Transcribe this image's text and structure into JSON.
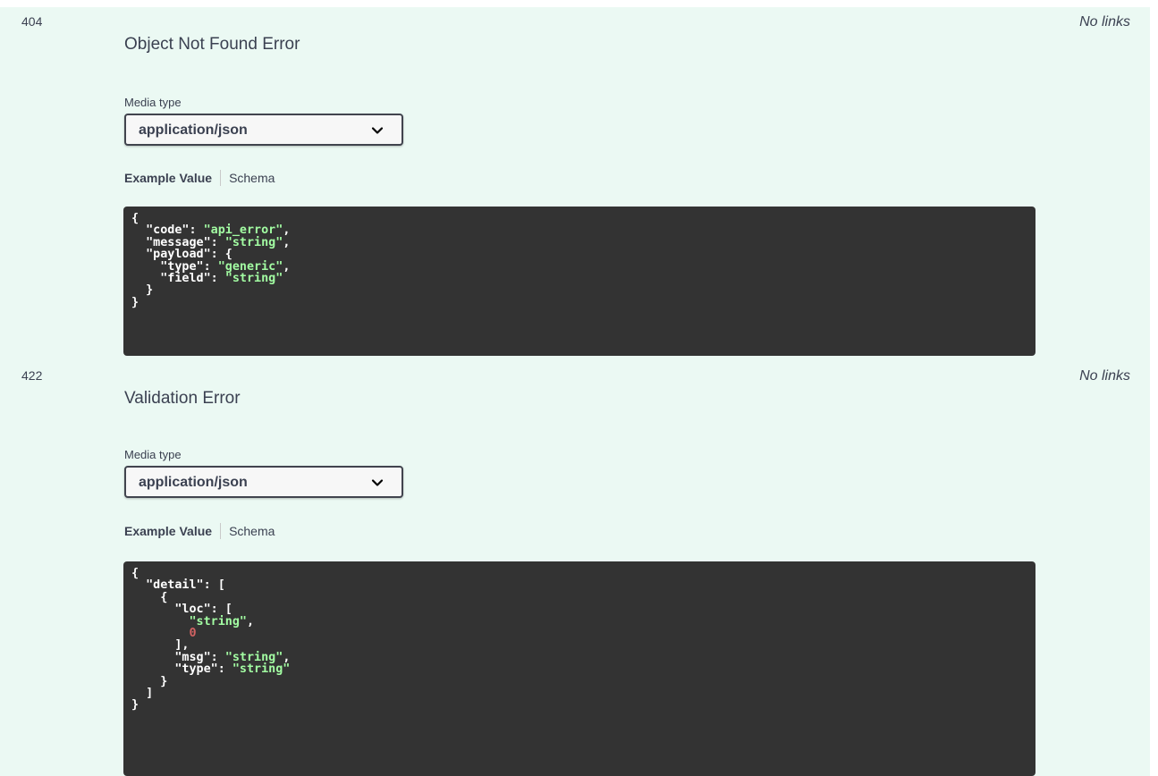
{
  "responses": [
    {
      "code": "404",
      "description": "Object Not Found Error",
      "links": "No links",
      "media_type_label": "Media type",
      "media_type_value": "application/json",
      "tabs": {
        "example": "Example Value",
        "schema": "Schema"
      },
      "example_lines": [
        [
          {
            "t": "{"
          }
        ],
        [
          {
            "t": "  \"code\": "
          },
          {
            "t": "\"api_error\"",
            "c": "s"
          },
          {
            "t": ","
          }
        ],
        [
          {
            "t": "  \"message\": "
          },
          {
            "t": "\"string\"",
            "c": "s"
          },
          {
            "t": ","
          }
        ],
        [
          {
            "t": "  \"payload\": {"
          }
        ],
        [
          {
            "t": "    \"type\": "
          },
          {
            "t": "\"generic\"",
            "c": "s"
          },
          {
            "t": ","
          }
        ],
        [
          {
            "t": "    \"field\": "
          },
          {
            "t": "\"string\"",
            "c": "s"
          }
        ],
        [
          {
            "t": "  }"
          }
        ],
        [
          {
            "t": "}"
          }
        ]
      ]
    },
    {
      "code": "422",
      "description": "Validation Error",
      "links": "No links",
      "media_type_label": "Media type",
      "media_type_value": "application/json",
      "tabs": {
        "example": "Example Value",
        "schema": "Schema"
      },
      "example_lines": [
        [
          {
            "t": "{"
          }
        ],
        [
          {
            "t": "  \"detail\": ["
          }
        ],
        [
          {
            "t": "    {"
          }
        ],
        [
          {
            "t": "      \"loc\": ["
          }
        ],
        [
          {
            "t": "        "
          },
          {
            "t": "\"string\"",
            "c": "s"
          },
          {
            "t": ","
          }
        ],
        [
          {
            "t": "        "
          },
          {
            "t": "0",
            "c": "n"
          }
        ],
        [
          {
            "t": "      ],"
          }
        ],
        [
          {
            "t": "      \"msg\": "
          },
          {
            "t": "\"string\"",
            "c": "s"
          },
          {
            "t": ","
          }
        ],
        [
          {
            "t": "      \"type\": "
          },
          {
            "t": "\"string\"",
            "c": "s"
          }
        ],
        [
          {
            "t": "    }"
          }
        ],
        [
          {
            "t": "  ]"
          }
        ],
        [
          {
            "t": "}"
          }
        ]
      ]
    }
  ],
  "colors": {
    "panel_bg": "#ebf9f3",
    "code_bg": "#333333",
    "string": "#a2fca2",
    "number": "#d36363"
  }
}
